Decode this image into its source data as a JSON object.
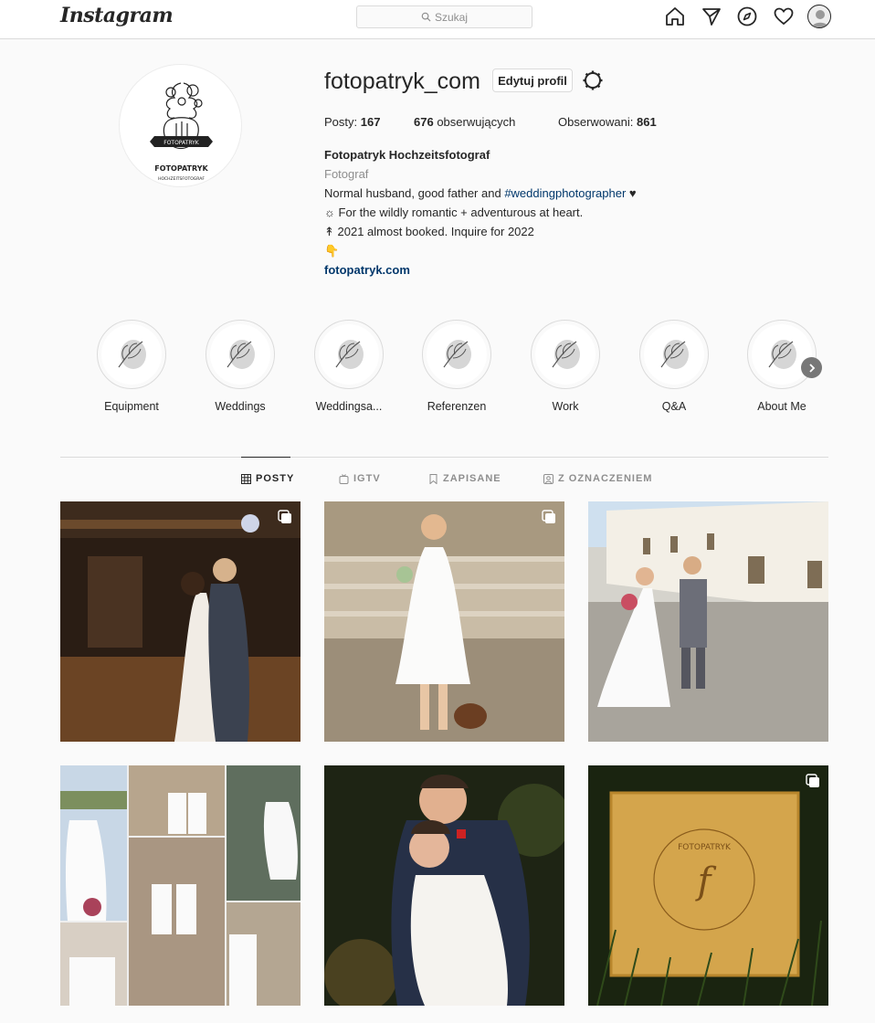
{
  "topbar": {
    "logo": "Instagram",
    "search_placeholder": "Szukaj"
  },
  "profile": {
    "username": "fotopatryk_com",
    "edit_label": "Edytuj profil",
    "stats": {
      "posts_label": "Posty:",
      "posts_count": "167",
      "followers_count": "676",
      "followers_label": "obserwujących",
      "following_label": "Obserwowani:",
      "following_count": "861"
    },
    "logo_text_top": "FOTOPATRYK",
    "logo_text_ribbon": "FOTOPATRYK",
    "logo_text_bottom": "HOCHZEITSFOTOGRAF",
    "bio": {
      "name": "Fotopatryk Hochzeitsfotograf",
      "category": "Fotograf",
      "line1_prefix": "Normal husband, good father and ",
      "line1_tag": "#weddingphotographer",
      "line1_suffix": " ♥",
      "line2": "☼ For the wildly romantic + adventurous at heart.",
      "line3": "↟ 2021 almost booked. Inquire for 2022",
      "line4": "👇",
      "link": "fotopatryk.com"
    }
  },
  "highlights": [
    {
      "label": "Equipment"
    },
    {
      "label": "Weddings"
    },
    {
      "label": "Weddingsa..."
    },
    {
      "label": "Referenzen"
    },
    {
      "label": "Work"
    },
    {
      "label": "Q&A"
    },
    {
      "label": "About Me"
    }
  ],
  "tabs": [
    {
      "label": "POSTY",
      "icon": "grid-icon",
      "active": true
    },
    {
      "label": "IGTV",
      "icon": "igtv-icon",
      "active": false
    },
    {
      "label": "ZAPISANE",
      "icon": "bookmark-icon",
      "active": false
    },
    {
      "label": "Z OZNACZENIEM",
      "icon": "tagged-icon",
      "active": false
    }
  ],
  "posts": [
    {
      "description": "couple-embrace-barn",
      "multi": true
    },
    {
      "description": "bride-with-dog-on-stairs",
      "multi": true
    },
    {
      "description": "couple-walking-courtyard",
      "multi": false
    },
    {
      "description": "collage-two-brides",
      "multi": false
    },
    {
      "description": "groom-hugging-bride",
      "multi": false
    },
    {
      "description": "wooden-box-fotopatryk",
      "multi": true
    }
  ],
  "post_box_text": "FOTOPATRYK",
  "post_box_monogram": "f",
  "colors": {
    "link": "#00376b",
    "border": "#dbdbdb",
    "muted": "#8e8e8e"
  }
}
